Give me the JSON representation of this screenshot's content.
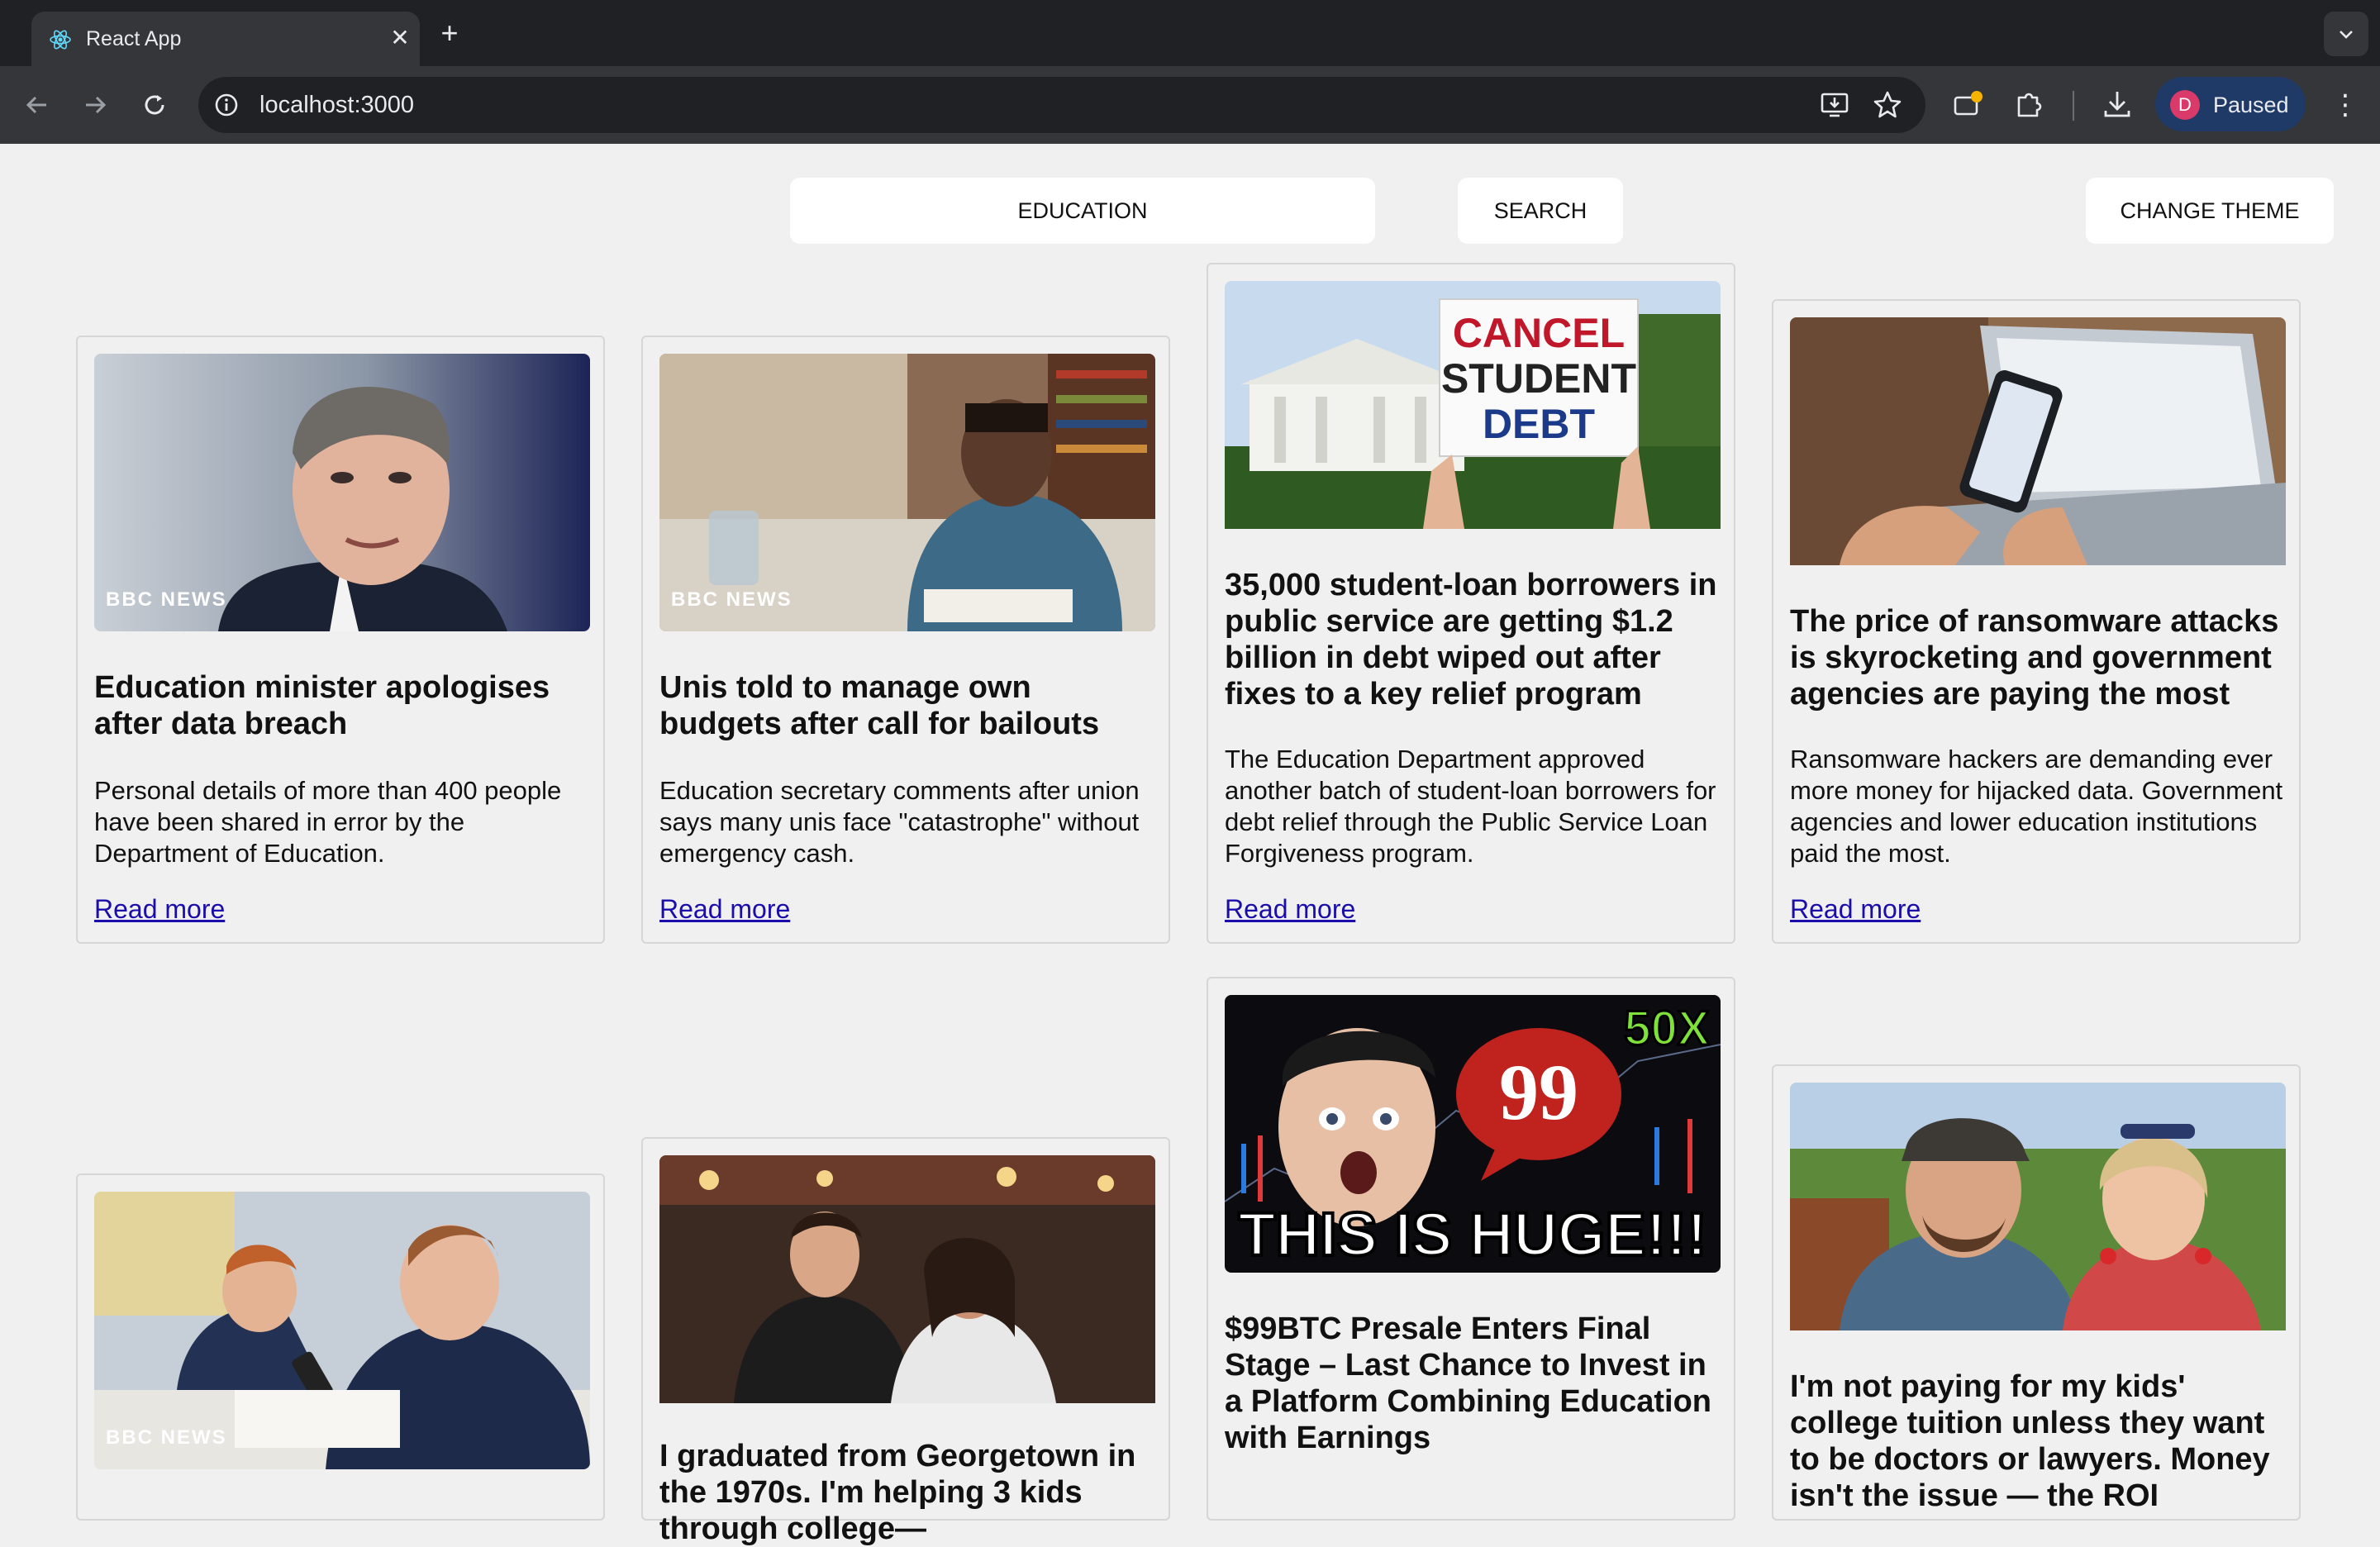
{
  "browser": {
    "tab_title": "React App",
    "url": "localhost:3000",
    "profile_initial": "D",
    "profile_status": "Paused"
  },
  "controls": {
    "search_value": "EDUCATION",
    "search_button": "SEARCH",
    "theme_button": "CHANGE THEME"
  },
  "cards": [
    {
      "title": "Education minister apologises after data breach",
      "description": "Personal details of more than 400 people have been shared in error by the Department of Education.",
      "link": "Read more",
      "image_badge": "BBC NEWS"
    },
    {
      "title": "Unis told to manage own budgets after call for bailouts",
      "description": "Education secretary comments after union says many unis face \"catastrophe\" without emergency cash.",
      "link": "Read more",
      "image_badge": "BBC NEWS"
    },
    {
      "title": "35,000 student-loan borrowers in public service are getting $1.2 billion in debt wiped out after fixes to a key relief program",
      "description": "The Education Department approved another batch of student-loan borrowers for debt relief through the Public Service Loan Forgiveness program.",
      "link": "Read more",
      "image_sign": [
        "CANCEL",
        "STUDENT",
        "DEBT"
      ]
    },
    {
      "title": "The price of ransomware attacks is skyrocketing and government agencies are paying the most",
      "description": "Ransomware hackers are demanding ever more money for hijacked data. Government agencies and lower education institutions paid the most.",
      "link": "Read more"
    },
    {
      "title": "",
      "image_badge": "BBC NEWS"
    },
    {
      "title": "I graduated from Georgetown in the 1970s. I'm helping 3 kids through college—"
    },
    {
      "title": "$99BTC Presale Enters Final Stage – Last Chance to Invest in a Platform Combining Education with Earnings",
      "image_text": {
        "top": "50X",
        "bubble": "99",
        "bottom": "THIS IS HUGE!!!"
      }
    },
    {
      "title": "I'm not paying for my kids' college tuition unless they want to be doctors or lawyers. Money isn't the issue — the ROI"
    }
  ],
  "colors": {
    "page_background": "#f0f0f0",
    "link": "#1a0dab",
    "chrome_dark": "#202124",
    "chrome_toolbar": "#35363a"
  }
}
